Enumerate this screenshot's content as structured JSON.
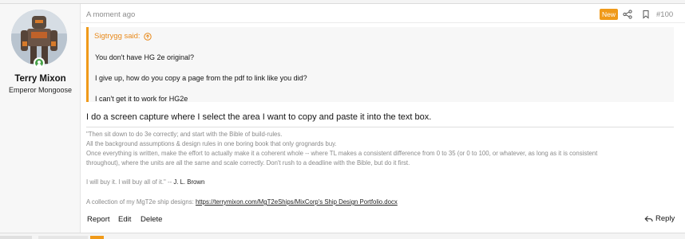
{
  "user": {
    "name": "Terry Mixon",
    "title": "Emperor Mongoose"
  },
  "post": {
    "timestamp": "A moment ago",
    "new_badge": "New",
    "post_number": "#100",
    "quote": {
      "author_said": "Sigtrygg said:",
      "lines": [
        "You don't have HG 2e original?",
        "I give up, how do you copy a page from the pdf to link like you did?",
        "I can't get it to work for HG2e"
      ]
    },
    "body": "I do a screen capture where I select the area I want to copy and paste it into the text box.",
    "signature": {
      "line1": "\"Then sit down to do 3e correctly; and start with the Bible of build-rules.",
      "line2": "All the background assumptions & design rules in one boring book that only grognards buy.",
      "line3": "Once everything is written, make the effort to actually make it a coherent whole -- where TL makes a consistent difference from 0 to 35 (or 0 to 100, or whatever, as long as it is consistent",
      "line4": "throughout), where the units are all the same and scale correctly. Don't rush to a deadline with the Bible, but do it first.",
      "line5_prefix": "I will buy it. I will buy all of it.\" --",
      "line5_author": "J. L. Brown",
      "line6_prefix": "A collection of my MgT2e ship designs:",
      "line6_link": "https://terrymixon.com/MgT2eShips/MixCorp's Ship Design Portfolio.docx"
    },
    "actions": {
      "report": "Report",
      "edit": "Edit",
      "delete": "Delete",
      "reply": "Reply"
    }
  },
  "colors": {
    "accent": "#f09a1a",
    "online": "#48a148"
  }
}
